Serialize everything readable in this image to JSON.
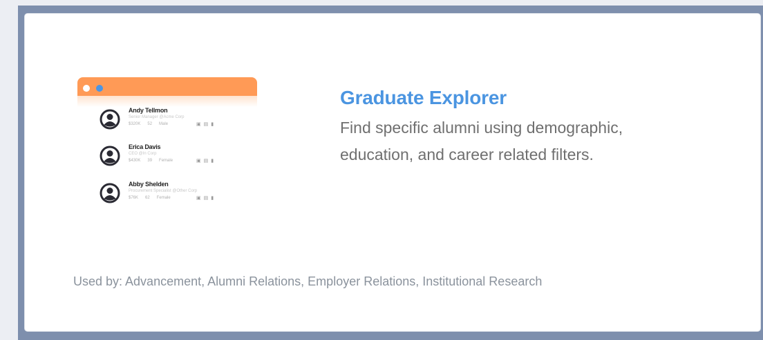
{
  "card": {
    "title": "Graduate Explorer",
    "description_line1": "Find specific alumni using demographic,",
    "description_line2": "education, and career related filters.",
    "used_by": "Used by: Advancement, Alumni Relations, Employer Relations, Institutional Research"
  },
  "illustration": {
    "people": [
      {
        "name": "Andy Tellmon",
        "role": "Senior Manager @Acme Corp",
        "salary": "$320K",
        "age": "52",
        "gender": "Male"
      },
      {
        "name": "Erica Davis",
        "role": "CEO @In Corp",
        "salary": "$430K",
        "age": "39",
        "gender": "Female"
      },
      {
        "name": "Abby Shelden",
        "role": "Procurement Specialist @Other Corp",
        "salary": "$76K",
        "age": "62",
        "gender": "Female"
      }
    ]
  },
  "colors": {
    "accent_title": "#4b95e1",
    "header_bar": "#ff9a56",
    "frame": "#7e8fad"
  },
  "icons": [
    "user-avatar-icon",
    "mail-icon",
    "calendar-icon",
    "chart-icon"
  ]
}
